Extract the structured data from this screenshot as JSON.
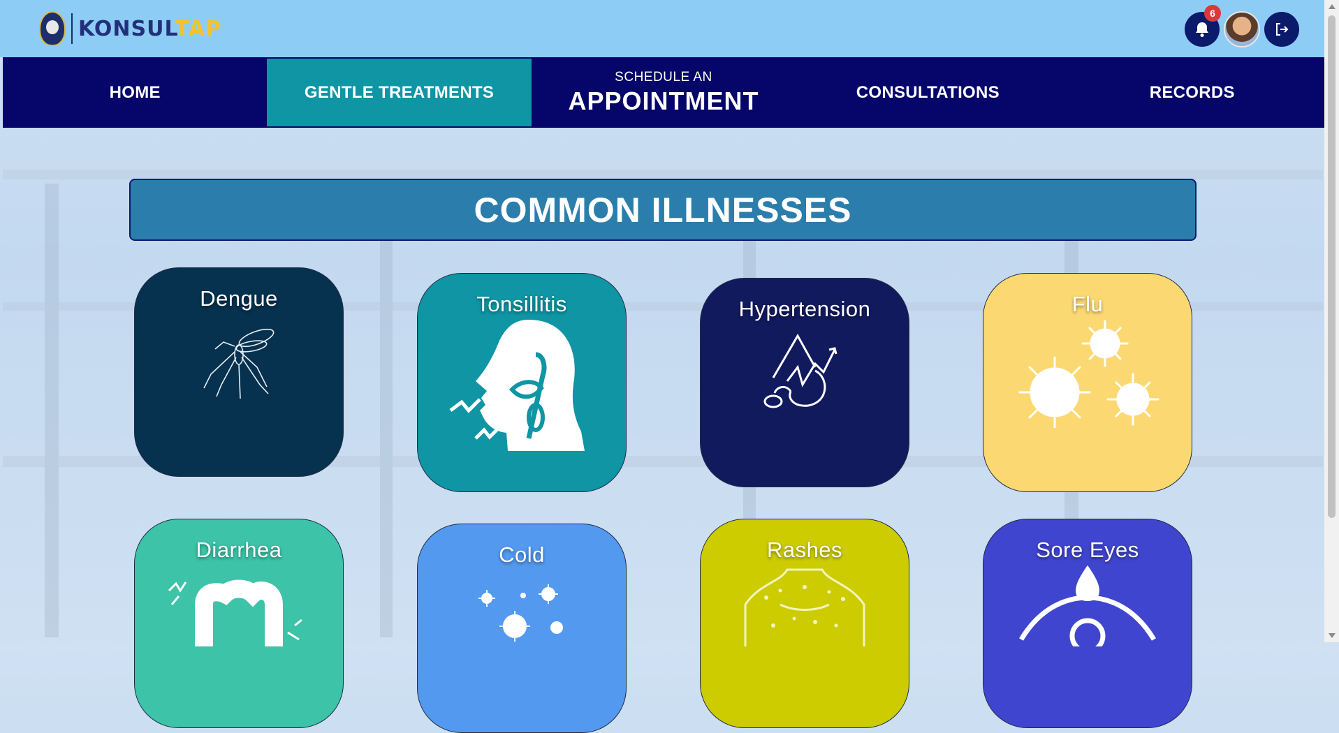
{
  "app": {
    "logo_part1": "KONSUL",
    "logo_part2": "TAP",
    "notifications_count": "6"
  },
  "nav": {
    "home": "HOME",
    "gentle": "GENTLE TREATMENTS",
    "schedule_small": "SCHEDULE AN",
    "schedule_big": "APPOINTMENT",
    "consultations": "CONSULTATIONS",
    "records": "RECORDS"
  },
  "main": {
    "heading": "COMMON ILLNESSES",
    "illnesses": [
      {
        "label": "Dengue",
        "color": "#06314f",
        "icon": "mosquito-icon"
      },
      {
        "label": "Tonsillitis",
        "color": "#0f95a4",
        "icon": "throat-icon"
      },
      {
        "label": "Hypertension",
        "color": "#121a5e",
        "icon": "blood-pressure-icon"
      },
      {
        "label": "Flu",
        "color": "#fbd872",
        "icon": "virus-icon"
      },
      {
        "label": "Diarrhea",
        "color": "#3cc3a8",
        "icon": "intestine-icon"
      },
      {
        "label": "Cold",
        "color": "#5399ef",
        "icon": "germs-icon"
      },
      {
        "label": "Rashes",
        "color": "#cccc00",
        "icon": "skin-rash-icon"
      },
      {
        "label": "Sore Eyes",
        "color": "#3f45cf",
        "icon": "eye-drop-icon"
      }
    ]
  },
  "colors": {
    "topbar": "#8dcdf5",
    "nav_bg": "#05056a",
    "nav_active": "#0f95a4",
    "heading_bg": "#2b7eac"
  }
}
